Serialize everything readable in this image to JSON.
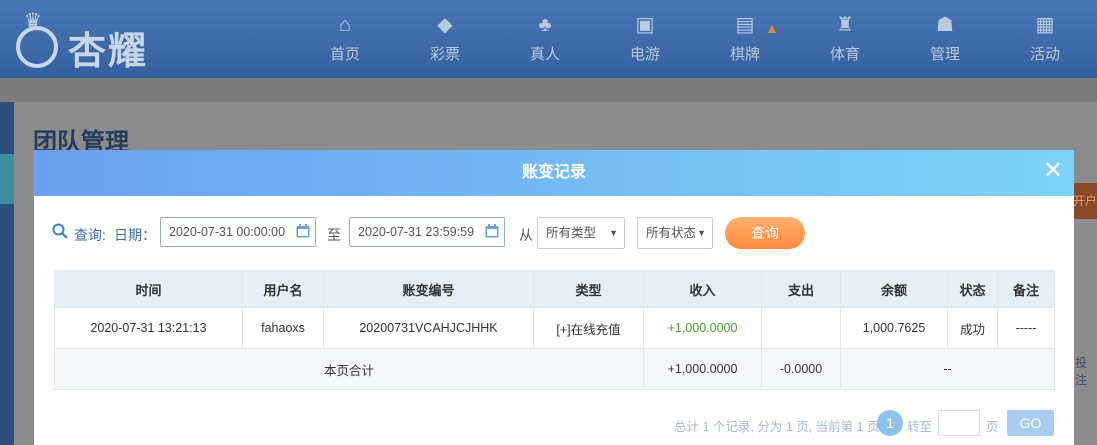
{
  "header": {
    "logo_text": "杏耀",
    "nav": [
      {
        "label": "首页",
        "icon": "home-icon"
      },
      {
        "label": "彩票",
        "icon": "lottery-icon"
      },
      {
        "label": "真人",
        "icon": "live-casino-icon"
      },
      {
        "label": "电游",
        "icon": "slot-machine-icon"
      },
      {
        "label": "棋牌",
        "icon": "cards-icon"
      },
      {
        "label": "体育",
        "icon": "trophy-icon"
      },
      {
        "label": "管理",
        "icon": "users-icon"
      },
      {
        "label": "活动",
        "icon": "gift-icon"
      }
    ]
  },
  "page": {
    "title": "团队管理",
    "side_tab_text": "开户",
    "side_text": "投注"
  },
  "modal": {
    "title": "账变记录",
    "search": {
      "query_label": "查询:",
      "date_label": "日期：",
      "start_date": "2020-07-31 00:00:00",
      "to_label": "至",
      "end_date": "2020-07-31 23:59:59",
      "from_label": "从",
      "type_select": "所有类型",
      "status_select": "所有状态",
      "query_button": "查询"
    },
    "table": {
      "headers": [
        "时间",
        "用户名",
        "账变编号",
        "类型",
        "收入",
        "支出",
        "余额",
        "状态",
        "备注"
      ],
      "rows": [
        {
          "time": "2020-07-31 13:21:13",
          "username": "fahaoxs",
          "txn_id": "20200731VCAHJCJHHK",
          "type": "[+]在线充值",
          "income": "+1,000.0000",
          "expense": "",
          "balance": "1,000.7625",
          "status": "成功",
          "remark": "-----"
        }
      ],
      "summary": {
        "label": "本页合计",
        "income": "+1,000.0000",
        "expense": "-0.0000",
        "balance": "--"
      }
    },
    "pager": {
      "summary_text": "总计 1 个记录, 分为 1 页, 当前第 1 页",
      "current_page": "1",
      "goto_label": "转至",
      "page_unit": "页",
      "go_button": "GO"
    }
  },
  "colors": {
    "header_bg": "#3d68a8",
    "modal_header_start": "#6aa0f0",
    "modal_header_end": "#7dd3f7",
    "query_button": "#ff8a3d",
    "income_green": "#4a9a2a"
  }
}
